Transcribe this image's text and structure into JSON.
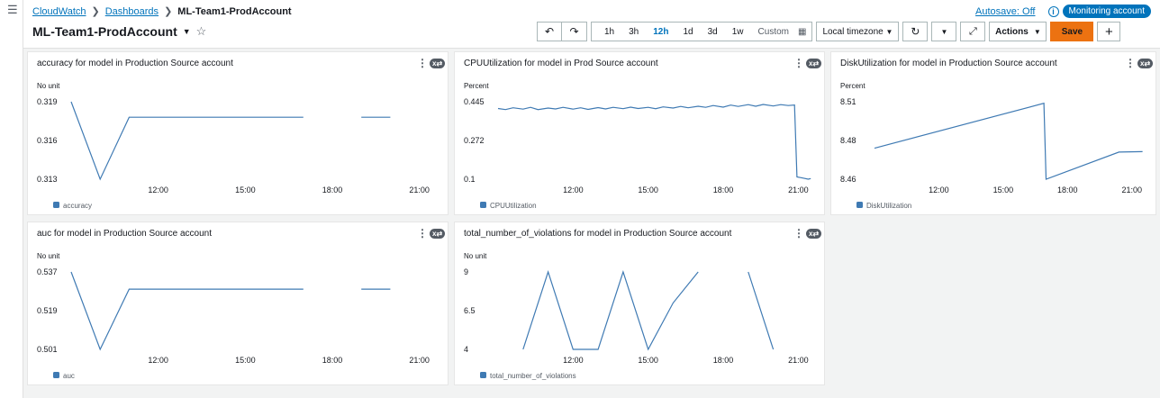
{
  "breadcrumb": {
    "root": "CloudWatch",
    "section": "Dashboards",
    "current": "ML-Team1-ProdAccount"
  },
  "header": {
    "autosave": "Autosave: Off",
    "monitoring": "Monitoring account",
    "title": "ML-Team1-ProdAccount"
  },
  "toolbar": {
    "ranges": [
      "1h",
      "3h",
      "12h",
      "1d",
      "3d",
      "1w"
    ],
    "active_range": "12h",
    "custom": "Custom",
    "timezone": "Local timezone",
    "actions": "Actions",
    "save": "Save"
  },
  "colors": {
    "series": "#3f7ab3",
    "accent": "#0073bb",
    "save": "#ec7211"
  },
  "widgets": [
    {
      "title": "accuracy for model in Production Source account",
      "chart_data": {
        "type": "line",
        "title": "accuracy for model in Production Source account",
        "ylabel": "No unit",
        "yticks": [
          "0.319",
          "0.316",
          "0.313"
        ],
        "ylim": [
          0.313,
          0.319
        ],
        "xticks": [
          "12:00",
          "15:00",
          "18:00",
          "21:00"
        ],
        "xlim": [
          9.0,
          21.6
        ],
        "series": [
          {
            "name": "accuracy",
            "segments": [
              [
                [
                  9.0,
                  0.319
                ],
                [
                  10.0,
                  0.313
                ],
                [
                  11.0,
                  0.3178
                ],
                [
                  17.0,
                  0.3178
                ]
              ],
              [
                [
                  19.0,
                  0.3178
                ],
                [
                  20.0,
                  0.3178
                ]
              ]
            ]
          }
        ]
      }
    },
    {
      "title": "CPUUtilization for model in Prod Source account",
      "chart_data": {
        "type": "line",
        "title": "CPUUtilization for model in Prod Source account",
        "ylabel": "Percent",
        "yticks": [
          "0.445",
          "0.272",
          "0.1"
        ],
        "ylim": [
          0.1,
          0.445
        ],
        "xticks": [
          "12:00",
          "15:00",
          "18:00",
          "21:00"
        ],
        "xlim": [
          9.0,
          21.6
        ],
        "series": [
          {
            "name": "CPUUtilization",
            "segments": [
              [
                [
                  9.0,
                  0.415
                ],
                [
                  9.3,
                  0.41
                ],
                [
                  9.6,
                  0.418
                ],
                [
                  10.0,
                  0.412
                ],
                [
                  10.3,
                  0.42
                ],
                [
                  10.6,
                  0.41
                ],
                [
                  11.0,
                  0.417
                ],
                [
                  11.3,
                  0.413
                ],
                [
                  11.6,
                  0.42
                ],
                [
                  12.0,
                  0.412
                ],
                [
                  12.3,
                  0.418
                ],
                [
                  12.6,
                  0.411
                ],
                [
                  13.0,
                  0.419
                ],
                [
                  13.3,
                  0.413
                ],
                [
                  13.6,
                  0.42
                ],
                [
                  14.0,
                  0.414
                ],
                [
                  14.3,
                  0.421
                ],
                [
                  14.6,
                  0.415
                ],
                [
                  15.0,
                  0.42
                ],
                [
                  15.3,
                  0.414
                ],
                [
                  15.6,
                  0.422
                ],
                [
                  16.0,
                  0.417
                ],
                [
                  16.3,
                  0.424
                ],
                [
                  16.6,
                  0.418
                ],
                [
                  17.0,
                  0.425
                ],
                [
                  17.3,
                  0.42
                ],
                [
                  17.6,
                  0.428
                ],
                [
                  18.0,
                  0.421
                ],
                [
                  18.3,
                  0.43
                ],
                [
                  18.6,
                  0.424
                ],
                [
                  19.0,
                  0.432
                ],
                [
                  19.3,
                  0.425
                ],
                [
                  19.6,
                  0.433
                ],
                [
                  20.0,
                  0.426
                ],
                [
                  20.3,
                  0.432
                ],
                [
                  20.6,
                  0.428
                ],
                [
                  20.85,
                  0.43
                ],
                [
                  20.95,
                  0.11
                ],
                [
                  21.2,
                  0.105
                ],
                [
                  21.4,
                  0.1
                ],
                [
                  21.5,
                  0.103
                ]
              ]
            ]
          }
        ]
      }
    },
    {
      "title": "DiskUtilization for model in Production Source account",
      "chart_data": {
        "type": "line",
        "title": "DiskUtilization for model in Production Source account",
        "ylabel": "Percent",
        "yticks": [
          "8.51",
          "8.48",
          "8.46"
        ],
        "ylim": [
          8.46,
          8.51
        ],
        "xticks": [
          "12:00",
          "15:00",
          "18:00",
          "21:00"
        ],
        "xlim": [
          9.0,
          21.6
        ],
        "series": [
          {
            "name": "DiskUtilization",
            "segments": [
              [
                [
                  9.0,
                  8.48
                ],
                [
                  16.9,
                  8.509
                ],
                [
                  17.0,
                  8.46
                ],
                [
                  20.4,
                  8.4775
                ],
                [
                  21.5,
                  8.4778
                ]
              ]
            ]
          }
        ]
      }
    },
    {
      "title": "auc for model in Production Source account",
      "chart_data": {
        "type": "line",
        "title": "auc for model in Production Source account",
        "ylabel": "No unit",
        "yticks": [
          "0.537",
          "0.519",
          "0.501"
        ],
        "ylim": [
          0.501,
          0.537
        ],
        "xticks": [
          "12:00",
          "15:00",
          "18:00",
          "21:00"
        ],
        "xlim": [
          9.0,
          21.6
        ],
        "series": [
          {
            "name": "auc",
            "segments": [
              [
                [
                  9.0,
                  0.537
                ],
                [
                  10.0,
                  0.501
                ],
                [
                  11.0,
                  0.529
                ],
                [
                  17.0,
                  0.529
                ]
              ],
              [
                [
                  19.0,
                  0.529
                ],
                [
                  20.0,
                  0.529
                ]
              ]
            ]
          }
        ]
      }
    },
    {
      "title": "total_number_of_violations for model in Production Source account",
      "chart_data": {
        "type": "line",
        "title": "total_number_of_violations for model in Production Source account",
        "ylabel": "No unit",
        "yticks": [
          "9",
          "6.5",
          "4"
        ],
        "ylim": [
          4,
          9
        ],
        "xticks": [
          "12:00",
          "15:00",
          "18:00",
          "21:00"
        ],
        "xlim": [
          9.0,
          21.6
        ],
        "series": [
          {
            "name": "total_number_of_violations",
            "segments": [
              [
                [
                  10.0,
                  4
                ],
                [
                  11.0,
                  9
                ],
                [
                  12.0,
                  4
                ],
                [
                  13.0,
                  4
                ],
                [
                  14.0,
                  9
                ],
                [
                  15.0,
                  4
                ],
                [
                  16.0,
                  7
                ],
                [
                  17.0,
                  9
                ]
              ],
              [
                [
                  19.0,
                  9
                ],
                [
                  20.0,
                  4
                ]
              ]
            ]
          }
        ]
      }
    }
  ]
}
